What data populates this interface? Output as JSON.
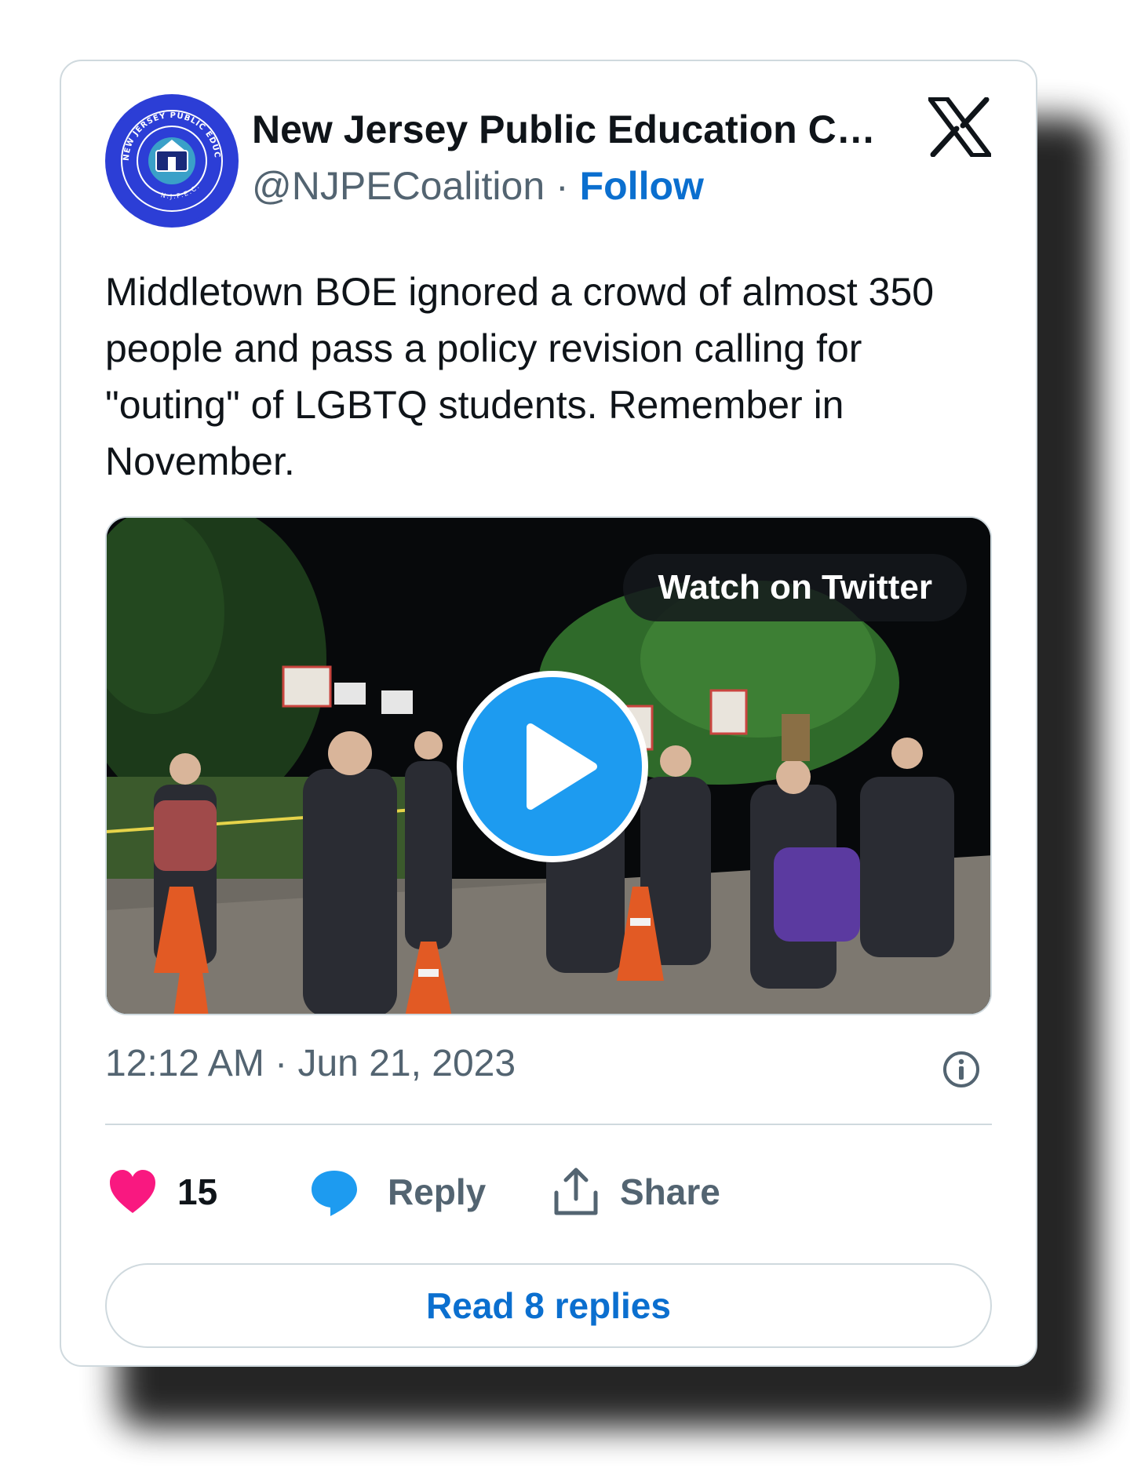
{
  "author": {
    "name": "New Jersey Public Education Co…",
    "handle": "@NJPECoalition",
    "separator": "·",
    "follow_label": "Follow",
    "avatar_ring_text": "NEW JERSEY PUBLIC EDUCATION COALITION",
    "avatar_bottom_text": "N.J.P.E.C."
  },
  "brand_icon": "x-logo-icon",
  "tweet": {
    "text": "Middletown BOE ignored a crowd of almost 350 people and pass a policy revision calling for \"outing\" of LGBTQ students. Remember in November."
  },
  "media": {
    "watch_label": "Watch on Twitter",
    "play_icon": "play-icon"
  },
  "meta": {
    "timestamp": "12:12 AM · Jun 21, 2023",
    "info_icon": "info-icon"
  },
  "actions": {
    "like_count": "15",
    "reply_label": "Reply",
    "share_label": "Share"
  },
  "footer": {
    "read_replies_label": "Read 8 replies"
  },
  "colors": {
    "accent": "#0b6fcf",
    "play": "#1d9bf0",
    "heart": "#f91880",
    "reply_bubble": "#1d9bf0",
    "muted": "#536471",
    "text": "#0f1419",
    "avatar": "#2c3ed6"
  }
}
